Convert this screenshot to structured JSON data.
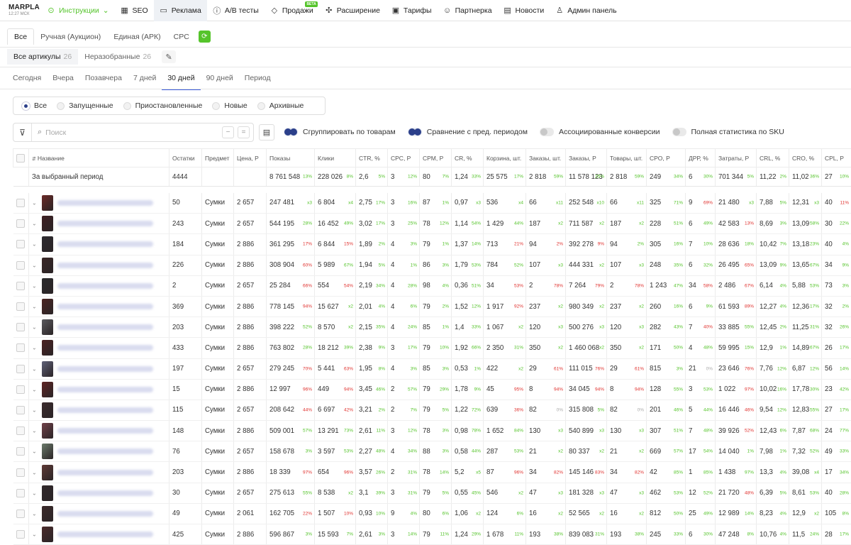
{
  "brand": {
    "name": "MARPLA",
    "time": "12:27 МСК"
  },
  "nav": [
    {
      "label": "Инструкции",
      "icon": "⊙",
      "name": "nav-instructions",
      "green": true,
      "chev": " ⌄"
    },
    {
      "label": "SEO",
      "icon": "▦",
      "name": "nav-seo"
    },
    {
      "label": "Реклама",
      "icon": "▭",
      "name": "nav-ads",
      "active": true
    },
    {
      "label": "A/B тесты",
      "icon": "ⓘ",
      "name": "nav-ab-tests"
    },
    {
      "label": "Продажи",
      "icon": "◇",
      "name": "nav-sales",
      "beta": "BETA"
    },
    {
      "label": "Расширение",
      "icon": "✣",
      "name": "nav-extension"
    },
    {
      "label": "Тарифы",
      "icon": "▣",
      "name": "nav-tariffs"
    },
    {
      "label": "Партнерка",
      "icon": "☺",
      "name": "nav-partners"
    },
    {
      "label": "Новости",
      "icon": "▤",
      "name": "nav-news"
    },
    {
      "label": "Админ панель",
      "icon": "♙",
      "name": "nav-admin"
    }
  ],
  "campaign_tabs": [
    "Все",
    "Ручная (Аукцион)",
    "Единая (АРК)",
    "CPC"
  ],
  "article_tabs": [
    {
      "label": "Все артикулы",
      "count": "26"
    },
    {
      "label": "Неразобранные",
      "count": "26"
    }
  ],
  "period_tabs": [
    "Сегодня",
    "Вчера",
    "Позавчера",
    "7 дней",
    "30 дней",
    "90 дней",
    "Период"
  ],
  "status_filters": [
    "Все",
    "Запущенные",
    "Приостановленные",
    "Новые",
    "Архивные"
  ],
  "search": {
    "placeholder": "Поиск"
  },
  "toggles": [
    {
      "label": "Сгруппировать по товарам",
      "on": true
    },
    {
      "label": "Сравнение с пред. периодом",
      "on": true
    },
    {
      "label": "Ассоциированные конверсии",
      "on": false
    },
    {
      "label": "Полная статистика по SKU",
      "on": false
    }
  ],
  "columns": [
    "Название",
    "Остатки",
    "Предмет",
    "Цена, Р",
    "Показы",
    "Клики",
    "CTR, %",
    "CPC, Р",
    "CPM, Р",
    "CR, %",
    "Корзина, шт.",
    "Заказы, шт.",
    "Заказы, Р",
    "Товары, шт.",
    "CPO, Р",
    "ДРР, %",
    "Затраты, Р",
    "CRL, %",
    "CRO, %",
    "CPL, Р"
  ],
  "summary": {
    "label": "За выбранный период",
    "cells": [
      [
        "4444",
        ""
      ],
      [
        "",
        ""
      ],
      [
        "",
        ""
      ],
      [
        "8 761 548",
        "13%"
      ],
      [
        "228 026",
        "8%"
      ],
      [
        "2,6",
        "5%"
      ],
      [
        "3",
        "12%"
      ],
      [
        "80",
        "7%"
      ],
      [
        "1,24",
        "33%"
      ],
      [
        "25 575",
        "17%"
      ],
      [
        "2 818",
        "59%"
      ],
      [
        "11 578 123",
        "25%"
      ],
      [
        "2 818",
        "59%"
      ],
      [
        "249",
        "34%"
      ],
      [
        "6",
        "30%"
      ],
      [
        "701 344",
        "5%"
      ],
      [
        "11,22",
        "2%"
      ],
      [
        "11,02",
        "36%"
      ],
      [
        "27",
        "10%"
      ]
    ]
  },
  "rows": [
    [
      [
        "50",
        ""
      ],
      [
        "Сумки",
        ""
      ],
      [
        "2 657",
        ""
      ],
      [
        "247 481",
        "x3"
      ],
      [
        "6 804",
        "x4"
      ],
      [
        "2,75",
        "17%"
      ],
      [
        "3",
        "16%"
      ],
      [
        "87",
        "1%"
      ],
      [
        "0,97",
        "x3"
      ],
      [
        "536",
        "x4"
      ],
      [
        "66",
        "x11"
      ],
      [
        "252 548",
        "x10"
      ],
      [
        "66",
        "x11"
      ],
      [
        "325",
        "71%"
      ],
      [
        "9",
        "69%"
      ],
      [
        "21 480",
        "x3"
      ],
      [
        "7,88",
        "5%"
      ],
      [
        "12,31",
        "x3"
      ],
      [
        "40",
        "11%"
      ]
    ],
    [
      [
        "243",
        ""
      ],
      [
        "Сумки",
        ""
      ],
      [
        "2 657",
        ""
      ],
      [
        "544 195",
        "28%"
      ],
      [
        "16 452",
        "49%"
      ],
      [
        "3,02",
        "17%"
      ],
      [
        "3",
        "25%"
      ],
      [
        "78",
        "12%"
      ],
      [
        "1,14",
        "54%"
      ],
      [
        "1 429",
        "44%"
      ],
      [
        "187",
        "x2"
      ],
      [
        "711 587",
        "x2"
      ],
      [
        "187",
        "x2"
      ],
      [
        "228",
        "51%"
      ],
      [
        "6",
        "49%"
      ],
      [
        "42 583",
        "13%"
      ],
      [
        "8,69",
        "3%"
      ],
      [
        "13,09",
        "58%"
      ],
      [
        "30",
        "22%"
      ]
    ],
    [
      [
        "184",
        ""
      ],
      [
        "Сумки",
        ""
      ],
      [
        "2 886",
        ""
      ],
      [
        "361 295",
        "17%"
      ],
      [
        "6 844",
        "15%"
      ],
      [
        "1,89",
        "2%"
      ],
      [
        "4",
        "3%"
      ],
      [
        "79",
        "1%"
      ],
      [
        "1,37",
        "14%"
      ],
      [
        "713",
        "21%"
      ],
      [
        "94",
        "2%"
      ],
      [
        "392 278",
        "9%"
      ],
      [
        "94",
        "2%"
      ],
      [
        "305",
        "16%"
      ],
      [
        "7",
        "10%"
      ],
      [
        "28 636",
        "18%"
      ],
      [
        "10,42",
        "7%"
      ],
      [
        "13,18",
        "23%"
      ],
      [
        "40",
        "4%"
      ]
    ],
    [
      [
        "226",
        ""
      ],
      [
        "Сумки",
        ""
      ],
      [
        "2 886",
        ""
      ],
      [
        "308 904",
        "60%"
      ],
      [
        "5 989",
        "67%"
      ],
      [
        "1,94",
        "5%"
      ],
      [
        "4",
        "1%"
      ],
      [
        "86",
        "3%"
      ],
      [
        "1,79",
        "53%"
      ],
      [
        "784",
        "52%"
      ],
      [
        "107",
        "x3"
      ],
      [
        "444 331",
        "x2"
      ],
      [
        "107",
        "x3"
      ],
      [
        "248",
        "35%"
      ],
      [
        "6",
        "32%"
      ],
      [
        "26 495",
        "65%"
      ],
      [
        "13,09",
        "9%"
      ],
      [
        "13,65",
        "67%"
      ],
      [
        "34",
        "9%"
      ]
    ],
    [
      [
        "2",
        ""
      ],
      [
        "Сумки",
        ""
      ],
      [
        "2 657",
        ""
      ],
      [
        "25 284",
        "66%"
      ],
      [
        "554",
        "54%"
      ],
      [
        "2,19",
        "34%"
      ],
      [
        "4",
        "28%"
      ],
      [
        "98",
        "4%"
      ],
      [
        "0,36",
        "51%"
      ],
      [
        "34",
        "53%"
      ],
      [
        "2",
        "78%"
      ],
      [
        "7 264",
        "79%"
      ],
      [
        "2",
        "78%"
      ],
      [
        "1 243",
        "47%"
      ],
      [
        "34",
        "58%"
      ],
      [
        "2 486",
        "67%"
      ],
      [
        "6,14",
        "4%"
      ],
      [
        "5,88",
        "53%"
      ],
      [
        "73",
        "3%"
      ]
    ],
    [
      [
        "369",
        ""
      ],
      [
        "Сумки",
        ""
      ],
      [
        "2 886",
        ""
      ],
      [
        "778 145",
        "94%"
      ],
      [
        "15 627",
        "x2"
      ],
      [
        "2,01",
        "4%"
      ],
      [
        "4",
        "6%"
      ],
      [
        "79",
        "2%"
      ],
      [
        "1,52",
        "12%"
      ],
      [
        "1 917",
        "92%"
      ],
      [
        "237",
        "x2"
      ],
      [
        "980 349",
        "x2"
      ],
      [
        "237",
        "x2"
      ],
      [
        "260",
        "16%"
      ],
      [
        "6",
        "9%"
      ],
      [
        "61 593",
        "89%"
      ],
      [
        "12,27",
        "4%"
      ],
      [
        "12,36",
        "17%"
      ],
      [
        "32",
        "2%"
      ]
    ],
    [
      [
        "203",
        ""
      ],
      [
        "Сумки",
        ""
      ],
      [
        "2 886",
        ""
      ],
      [
        "398 222",
        "52%"
      ],
      [
        "8 570",
        "x2"
      ],
      [
        "2,15",
        "35%"
      ],
      [
        "4",
        "24%"
      ],
      [
        "85",
        "1%"
      ],
      [
        "1,4",
        "33%"
      ],
      [
        "1 067",
        "x2"
      ],
      [
        "120",
        "x3"
      ],
      [
        "500 276",
        "x3"
      ],
      [
        "120",
        "x3"
      ],
      [
        "282",
        "43%"
      ],
      [
        "7",
        "40%"
      ],
      [
        "33 885",
        "55%"
      ],
      [
        "12,45",
        "2%"
      ],
      [
        "11,25",
        "31%"
      ],
      [
        "32",
        "26%"
      ]
    ],
    [
      [
        "433",
        ""
      ],
      [
        "Сумки",
        ""
      ],
      [
        "2 886",
        ""
      ],
      [
        "763 802",
        "28%"
      ],
      [
        "18 212",
        "39%"
      ],
      [
        "2,38",
        "9%"
      ],
      [
        "3",
        "17%"
      ],
      [
        "79",
        "10%"
      ],
      [
        "1,92",
        "66%"
      ],
      [
        "2 350",
        "31%"
      ],
      [
        "350",
        "x2"
      ],
      [
        "1 460 068",
        "x2"
      ],
      [
        "350",
        "x2"
      ],
      [
        "171",
        "50%"
      ],
      [
        "4",
        "48%"
      ],
      [
        "59 995",
        "15%"
      ],
      [
        "12,9",
        "1%"
      ],
      [
        "14,89",
        "67%"
      ],
      [
        "26",
        "17%"
      ]
    ],
    [
      [
        "197",
        ""
      ],
      [
        "Сумки",
        ""
      ],
      [
        "2 657",
        ""
      ],
      [
        "279 245",
        "70%"
      ],
      [
        "5 441",
        "63%"
      ],
      [
        "1,95",
        "8%"
      ],
      [
        "4",
        "3%"
      ],
      [
        "85",
        "3%"
      ],
      [
        "0,53",
        "1%"
      ],
      [
        "422",
        "x2"
      ],
      [
        "29",
        "61%"
      ],
      [
        "111 015",
        "76%"
      ],
      [
        "29",
        "61%"
      ],
      [
        "815",
        "3%"
      ],
      [
        "21",
        "0%"
      ],
      [
        "23 646",
        "76%"
      ],
      [
        "7,76",
        "12%"
      ],
      [
        "6,87",
        "12%"
      ],
      [
        "56",
        "14%"
      ]
    ],
    [
      [
        "15",
        ""
      ],
      [
        "Сумки",
        ""
      ],
      [
        "2 886",
        ""
      ],
      [
        "12 997",
        "96%"
      ],
      [
        "449",
        "94%"
      ],
      [
        "3,45",
        "46%"
      ],
      [
        "2",
        "57%"
      ],
      [
        "79",
        "29%"
      ],
      [
        "1,78",
        "9%"
      ],
      [
        "45",
        "95%"
      ],
      [
        "8",
        "94%"
      ],
      [
        "34 045",
        "94%"
      ],
      [
        "8",
        "94%"
      ],
      [
        "128",
        "55%"
      ],
      [
        "3",
        "53%"
      ],
      [
        "1 022",
        "97%"
      ],
      [
        "10,02",
        "16%"
      ],
      [
        "17,78",
        "30%"
      ],
      [
        "23",
        "42%"
      ]
    ],
    [
      [
        "115",
        ""
      ],
      [
        "Сумки",
        ""
      ],
      [
        "2 657",
        ""
      ],
      [
        "208 642",
        "44%"
      ],
      [
        "6 697",
        "42%"
      ],
      [
        "3,21",
        "2%"
      ],
      [
        "2",
        "7%"
      ],
      [
        "79",
        "5%"
      ],
      [
        "1,22",
        "72%"
      ],
      [
        "639",
        "36%"
      ],
      [
        "82",
        "0%"
      ],
      [
        "315 808",
        "5%"
      ],
      [
        "82",
        "0%"
      ],
      [
        "201",
        "46%"
      ],
      [
        "5",
        "44%"
      ],
      [
        "16 446",
        "46%"
      ],
      [
        "9,54",
        "12%"
      ],
      [
        "12,83",
        "55%"
      ],
      [
        "27",
        "17%"
      ]
    ],
    [
      [
        "148",
        ""
      ],
      [
        "Сумки",
        ""
      ],
      [
        "2 886",
        ""
      ],
      [
        "509 001",
        "57%"
      ],
      [
        "13 291",
        "73%"
      ],
      [
        "2,61",
        "11%"
      ],
      [
        "3",
        "12%"
      ],
      [
        "78",
        "3%"
      ],
      [
        "0,98",
        "78%"
      ],
      [
        "1 652",
        "84%"
      ],
      [
        "130",
        "x3"
      ],
      [
        "540 899",
        "x3"
      ],
      [
        "130",
        "x3"
      ],
      [
        "307",
        "51%"
      ],
      [
        "7",
        "48%"
      ],
      [
        "39 926",
        "52%"
      ],
      [
        "12,43",
        "6%"
      ],
      [
        "7,87",
        "68%"
      ],
      [
        "24",
        "77%"
      ]
    ],
    [
      [
        "76",
        ""
      ],
      [
        "Сумки",
        ""
      ],
      [
        "2 657",
        ""
      ],
      [
        "158 678",
        "3%"
      ],
      [
        "3 597",
        "53%"
      ],
      [
        "2,27",
        "48%"
      ],
      [
        "4",
        "34%"
      ],
      [
        "88",
        "3%"
      ],
      [
        "0,58",
        "44%"
      ],
      [
        "287",
        "53%"
      ],
      [
        "21",
        "x2"
      ],
      [
        "80 337",
        "x2"
      ],
      [
        "21",
        "x2"
      ],
      [
        "669",
        "57%"
      ],
      [
        "17",
        "54%"
      ],
      [
        "14 040",
        "1%"
      ],
      [
        "7,98",
        "1%"
      ],
      [
        "7,32",
        "52%"
      ],
      [
        "49",
        "33%"
      ]
    ],
    [
      [
        "203",
        ""
      ],
      [
        "Сумки",
        ""
      ],
      [
        "2 886",
        ""
      ],
      [
        "18 339",
        "97%"
      ],
      [
        "654",
        "96%"
      ],
      [
        "3,57",
        "26%"
      ],
      [
        "2",
        "31%"
      ],
      [
        "78",
        "14%"
      ],
      [
        "5,2",
        "x5"
      ],
      [
        "87",
        "96%"
      ],
      [
        "34",
        "82%"
      ],
      [
        "145 146",
        "83%"
      ],
      [
        "34",
        "82%"
      ],
      [
        "42",
        "85%"
      ],
      [
        "1",
        "85%"
      ],
      [
        "1 438",
        "97%"
      ],
      [
        "13,3",
        "4%"
      ],
      [
        "39,08",
        "x4"
      ],
      [
        "17",
        "34%"
      ]
    ],
    [
      [
        "30",
        ""
      ],
      [
        "Сумки",
        ""
      ],
      [
        "2 657",
        ""
      ],
      [
        "275 613",
        "55%"
      ],
      [
        "8 538",
        "x2"
      ],
      [
        "3,1",
        "39%"
      ],
      [
        "3",
        "31%"
      ],
      [
        "79",
        "5%"
      ],
      [
        "0,55",
        "45%"
      ],
      [
        "546",
        "x2"
      ],
      [
        "47",
        "x3"
      ],
      [
        "181 328",
        "x3"
      ],
      [
        "47",
        "x3"
      ],
      [
        "462",
        "53%"
      ],
      [
        "12",
        "52%"
      ],
      [
        "21 720",
        "48%"
      ],
      [
        "6,39",
        "5%"
      ],
      [
        "8,61",
        "53%"
      ],
      [
        "40",
        "28%"
      ]
    ],
    [
      [
        "49",
        ""
      ],
      [
        "Сумки",
        ""
      ],
      [
        "2 061",
        ""
      ],
      [
        "162 705",
        "22%"
      ],
      [
        "1 507",
        "10%"
      ],
      [
        "0,93",
        "10%"
      ],
      [
        "9",
        "4%"
      ],
      [
        "80",
        "6%"
      ],
      [
        "1,06",
        "x2"
      ],
      [
        "124",
        "6%"
      ],
      [
        "16",
        "x2"
      ],
      [
        "52 565",
        "x2"
      ],
      [
        "16",
        "x2"
      ],
      [
        "812",
        "50%"
      ],
      [
        "25",
        "49%"
      ],
      [
        "12 989",
        "14%"
      ],
      [
        "8,23",
        "4%"
      ],
      [
        "12,9",
        "x2"
      ],
      [
        "105",
        "8%"
      ]
    ],
    [
      [
        "425",
        ""
      ],
      [
        "Сумки",
        ""
      ],
      [
        "2 886",
        ""
      ],
      [
        "596 867",
        "3%"
      ],
      [
        "15 593",
        "7%"
      ],
      [
        "2,61",
        "3%"
      ],
      [
        "3",
        "14%"
      ],
      [
        "79",
        "11%"
      ],
      [
        "1,24",
        "29%"
      ],
      [
        "1 678",
        "11%"
      ],
      [
        "193",
        "38%"
      ],
      [
        "839 083",
        "31%"
      ],
      [
        "193",
        "38%"
      ],
      [
        "245",
        "33%"
      ],
      [
        "6",
        "30%"
      ],
      [
        "47 248",
        "8%"
      ],
      [
        "10,76",
        "4%"
      ],
      [
        "11,5",
        "24%"
      ],
      [
        "28",
        "17%"
      ]
    ]
  ],
  "colors": {
    "accent": "#55c42b",
    "primary": "#2b3f8a",
    "negative": "#e0322f"
  }
}
